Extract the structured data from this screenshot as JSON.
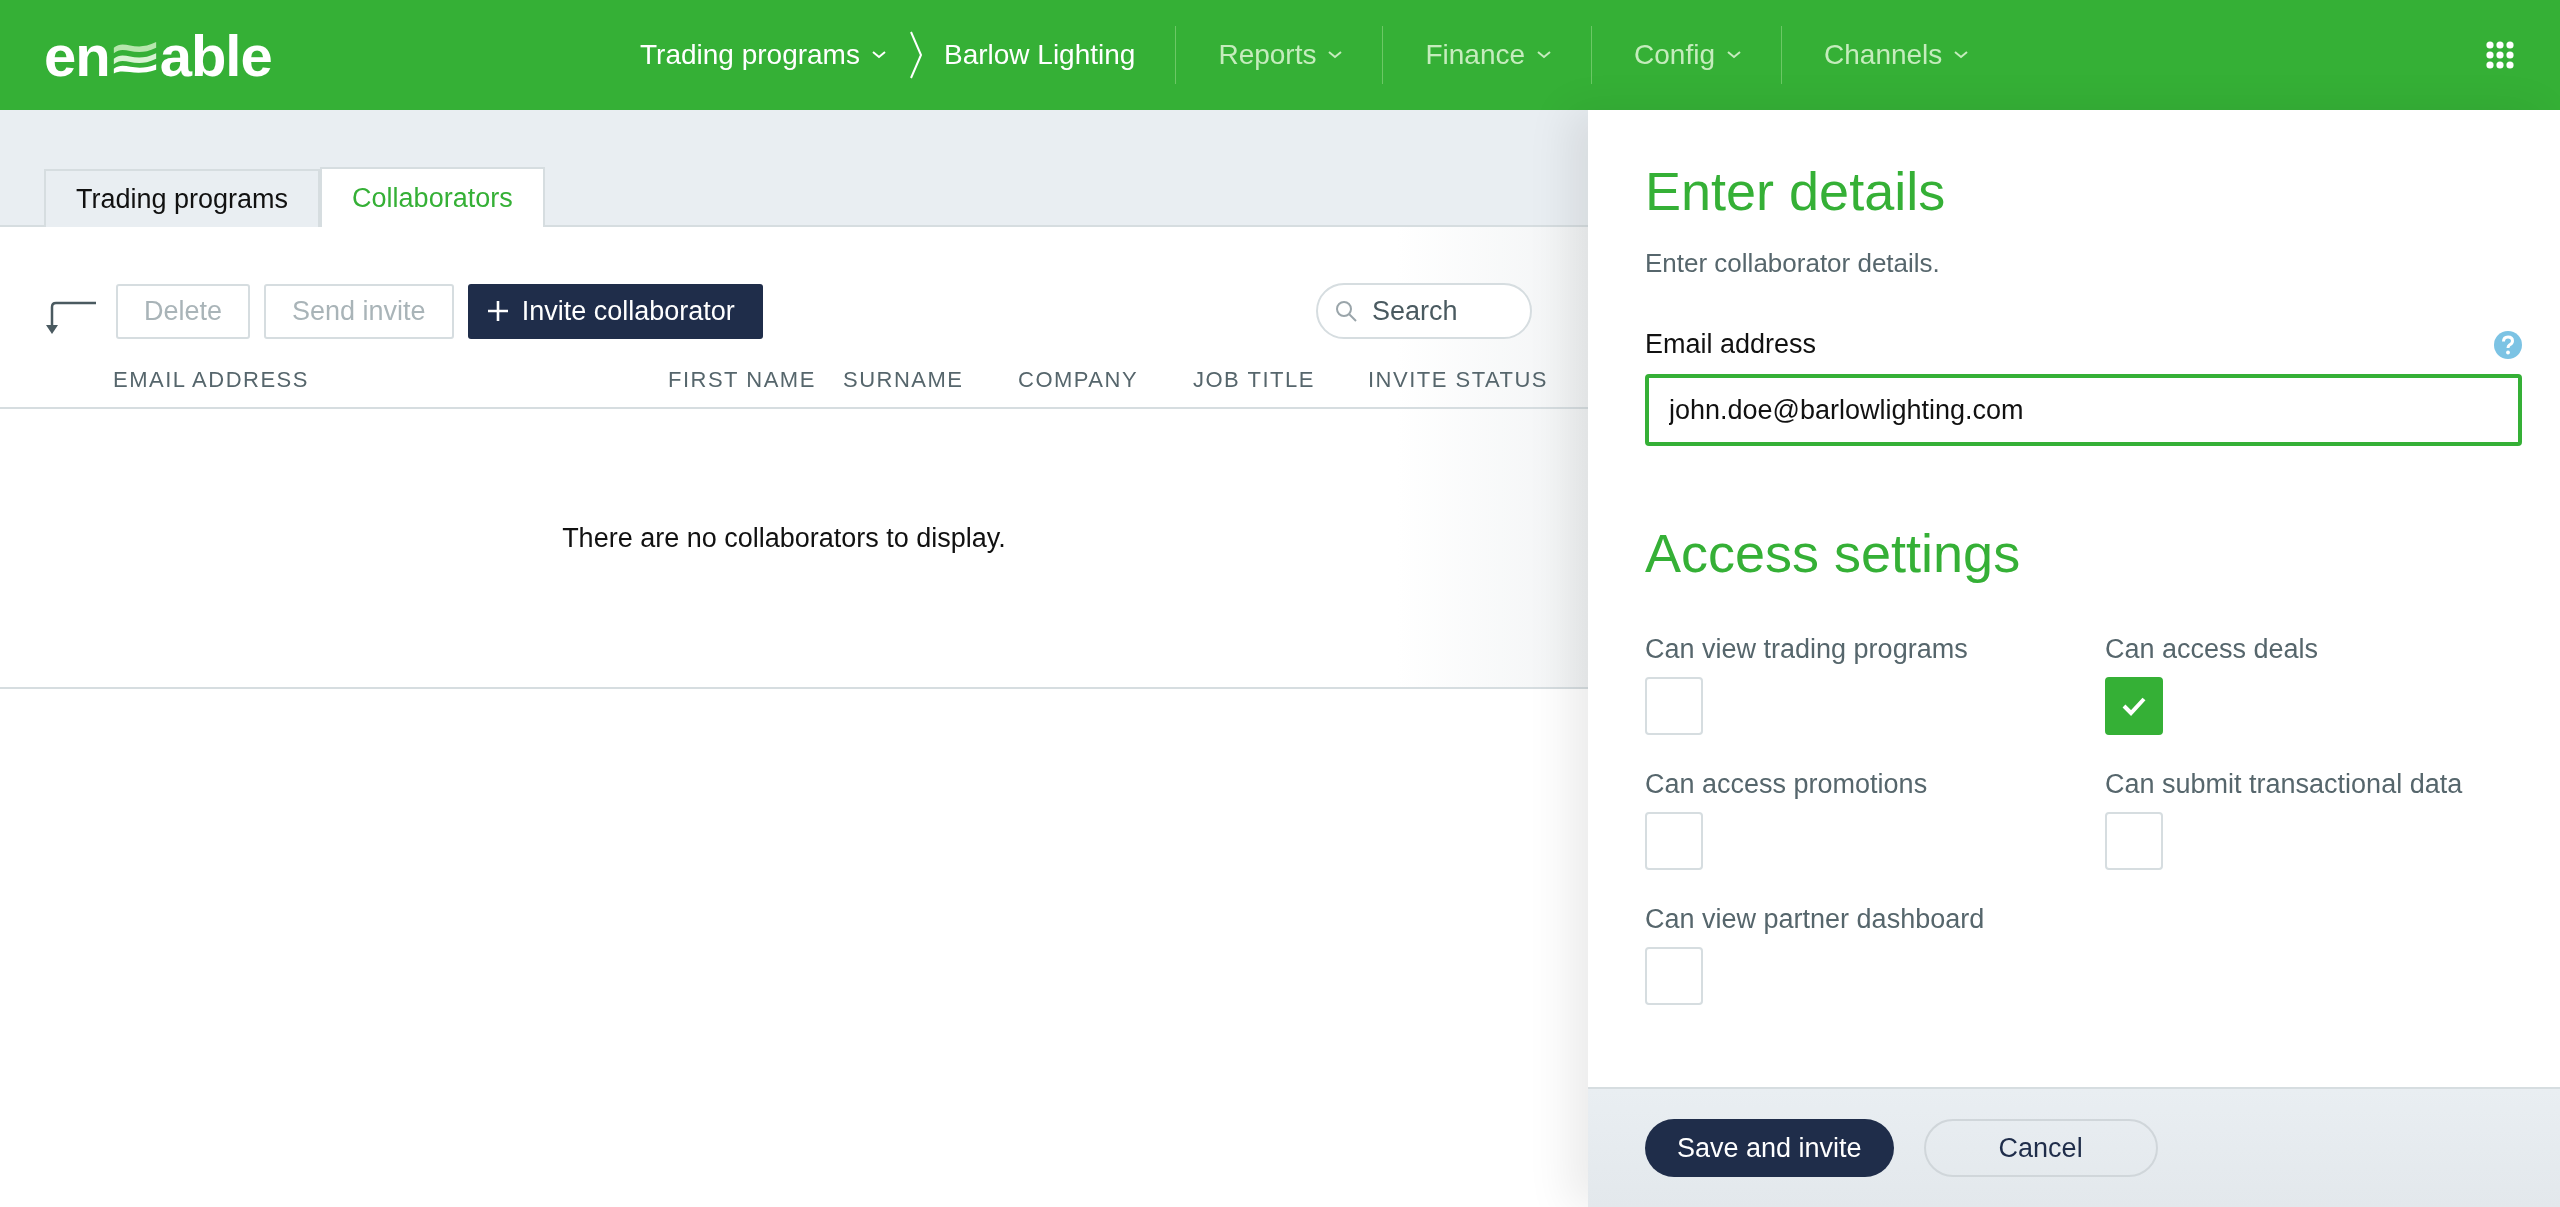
{
  "header": {
    "logo": [
      "en",
      "able"
    ],
    "breadcrumb": [
      {
        "label": "Trading programs",
        "has_menu": true
      },
      {
        "label": "Barlow Lighting",
        "has_menu": false
      }
    ],
    "menus": [
      {
        "label": "Reports"
      },
      {
        "label": "Finance"
      },
      {
        "label": "Config"
      },
      {
        "label": "Channels"
      }
    ]
  },
  "tabs": [
    {
      "label": "Trading programs",
      "selected": false
    },
    {
      "label": "Collaborators",
      "selected": true
    }
  ],
  "toolbar": {
    "buttons": [
      {
        "label": "Delete",
        "kind": "secondary",
        "disabled": true
      },
      {
        "label": "Send invite",
        "kind": "secondary",
        "disabled": true
      },
      {
        "label": "Invite collaborator",
        "kind": "primary",
        "disabled": false
      }
    ],
    "search": {
      "placeholder": "Search"
    }
  },
  "table": {
    "columns": [
      "EMAIL ADDRESS",
      "FIRST NAME",
      "SURNAME",
      "COMPANY",
      "JOB TITLE",
      "INVITE STATUS"
    ],
    "empty_message": "There are no collaborators to display."
  },
  "panel": {
    "title": "Enter details",
    "subtitle": "Enter collaborator details.",
    "email": {
      "label": "Email address",
      "value": "john.doe@barlowlighting.com"
    },
    "access_title": "Access settings",
    "permissions": [
      {
        "label": "Can view trading programs",
        "checked": false
      },
      {
        "label": "Can access deals",
        "checked": true
      },
      {
        "label": "Can access promotions",
        "checked": false
      },
      {
        "label": "Can submit transactional data",
        "checked": false
      },
      {
        "label": "Can view partner dashboard",
        "checked": false
      }
    ],
    "actions": [
      {
        "label": "Save and invite",
        "kind": "primary"
      },
      {
        "label": "Cancel",
        "kind": "secondary"
      }
    ]
  }
}
